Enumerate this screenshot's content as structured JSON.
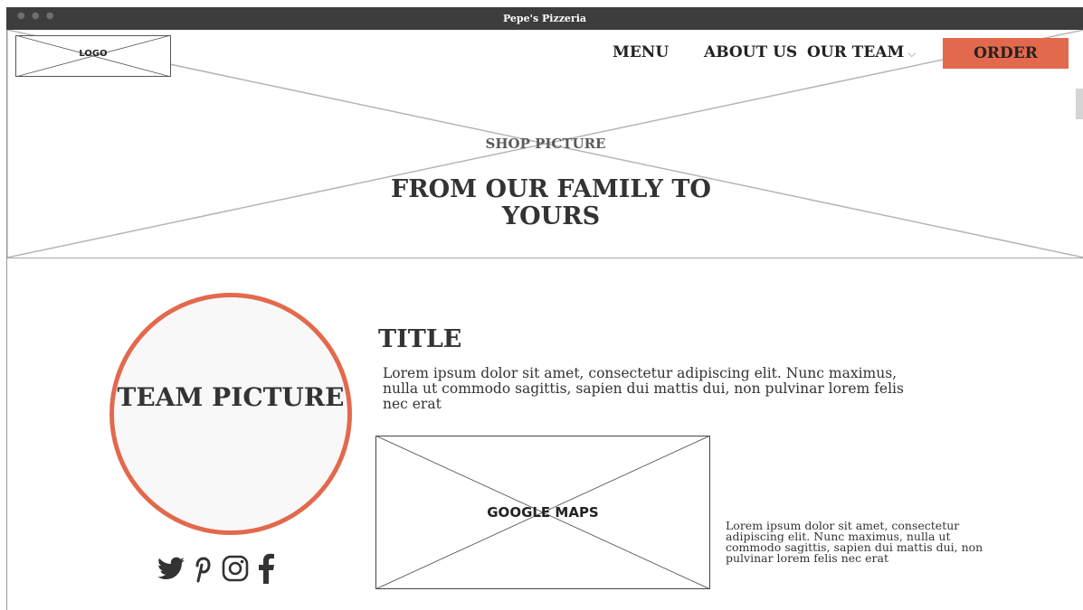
{
  "window": {
    "title": "Pepe's Pizzeria"
  },
  "header": {
    "logo_label": "LOGO",
    "nav": {
      "menu": "MENU",
      "about": "ABOUT US",
      "team": "OUR TEAM"
    },
    "order_label": "ORDER"
  },
  "hero": {
    "placeholder_label": "SHOP PICTURE",
    "tagline": "FROM OUR FAMILY TO YOURS"
  },
  "team": {
    "picture_label": "TEAM PICTURE",
    "socials": [
      "twitter-icon",
      "pinterest-icon",
      "instagram-icon",
      "facebook-icon"
    ]
  },
  "content": {
    "title": "TITLE",
    "paragraph": "Lorem ipsum dolor sit amet, consectetur adipiscing elit. Nunc maximus, nulla ut commodo sagittis, sapien dui mattis dui, non pulvinar lorem felis nec erat",
    "map_label": "GOOGLE MAPS",
    "side_paragraph": "Lorem ipsum dolor sit amet, consectetur adipiscing elit. Nunc maximus, nulla ut commodo sagittis, sapien dui mattis dui, non pulvinar lorem felis nec erat"
  },
  "colors": {
    "accent": "#e3694d",
    "titlebar": "#3d3d3d",
    "placeholder_line": "#b0b0b0"
  }
}
